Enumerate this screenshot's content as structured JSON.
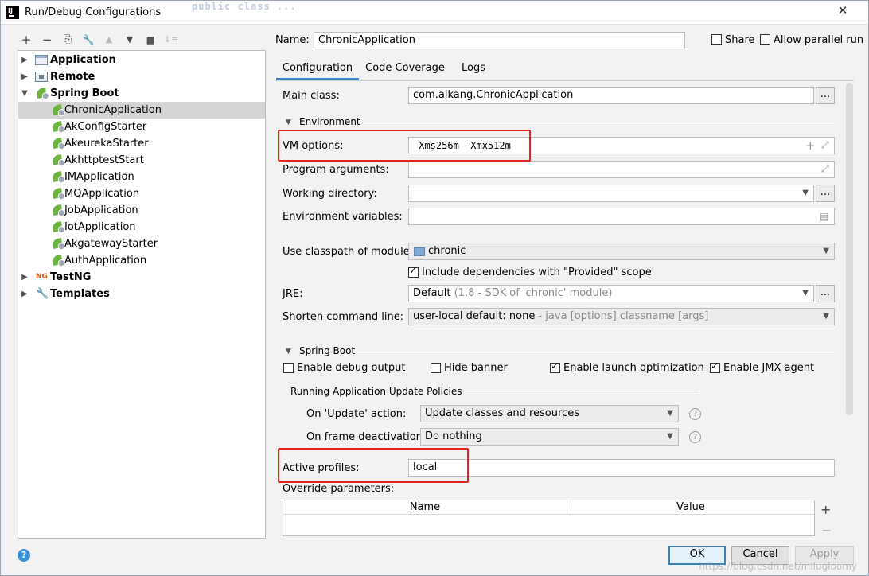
{
  "window": {
    "title": "Run/Debug Configurations",
    "app_icon": "IJ",
    "close": "✕",
    "ghost_code": "public class ..."
  },
  "toolbar": {
    "icons": [
      "plus-icon",
      "minus-icon",
      "copy-icon",
      "wrench-icon",
      "arrow-up-icon",
      "arrow-down-icon",
      "new-folder-icon",
      "sort-icon"
    ],
    "glyphs": [
      "+",
      "−",
      "⎘",
      "🔧",
      "▲",
      "▼",
      "▆",
      "↓≡"
    ]
  },
  "tree": {
    "application": "Application",
    "remote": "Remote",
    "spring_boot": "Spring Boot",
    "spring_children": [
      "ChronicApplication",
      "AkConfigStarter",
      "AkeurekaStarter",
      "AkhttptestStart",
      "IMApplication",
      "MQApplication",
      "JobApplication",
      "IotApplication",
      "AkgatewayStarter",
      "AuthApplication"
    ],
    "testng": "TestNG",
    "templates": "Templates",
    "testng_icon_text": "NG"
  },
  "header": {
    "name_label": "Name:",
    "name_value": "ChronicApplication",
    "share_label": "Share",
    "parallel_label": "Allow parallel run"
  },
  "tabs": [
    "Configuration",
    "Code Coverage",
    "Logs"
  ],
  "config": {
    "main_class_label": "Main class:",
    "main_class_value": "com.aikang.ChronicApplication",
    "environment_section": "Environment",
    "vm_options_label": "VM options:",
    "vm_options_value": "-Xms256m -Xmx512m",
    "program_args_label": "Program arguments:",
    "working_dir_label": "Working directory:",
    "env_vars_label": "Environment variables:",
    "classpath_label": "Use classpath of module:",
    "classpath_value": "chronic",
    "include_deps_label": "Include dependencies with \"Provided\" scope",
    "jre_label": "JRE:",
    "jre_value": "Default",
    "jre_hint": "(1.8 - SDK of 'chronic' module)",
    "shorten_label": "Shorten command line:",
    "shorten_value": "user-local default: none",
    "shorten_hint": "- java [options] classname [args]",
    "dots": "..."
  },
  "spring": {
    "section": "Spring Boot",
    "debug_output": "Enable debug output",
    "hide_banner": "Hide banner",
    "launch_opt": "Enable launch optimization",
    "jmx_agent": "Enable JMX agent",
    "policies_title": "Running Application Update Policies",
    "update_action_label": "On 'Update' action:",
    "update_action_value": "Update classes and resources",
    "frame_deactivation_label": "On frame deactivation:",
    "frame_deactivation_value": "Do nothing",
    "active_profiles_label": "Active profiles:",
    "active_profiles_value": "local",
    "override_label": "Override parameters:",
    "table_headers": [
      "Name",
      "Value"
    ],
    "table_plus": "+",
    "table_minus": "−"
  },
  "buttons": {
    "ok": "OK",
    "cancel": "Cancel",
    "apply": "Apply"
  },
  "watermark": "https://blog.csdn.net/milugloomy",
  "highlight_color": "#e4251f",
  "accent_color": "#4083c9"
}
